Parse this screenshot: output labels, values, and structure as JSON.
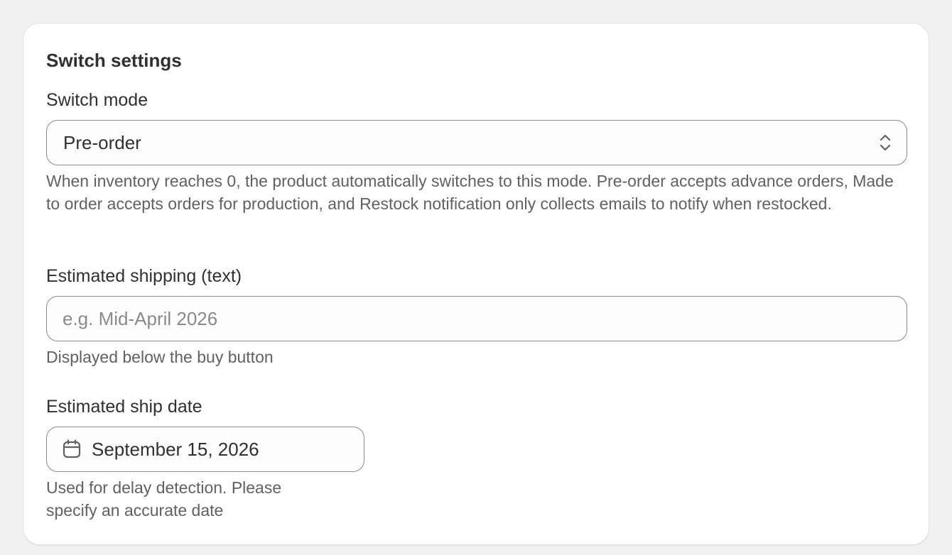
{
  "card": {
    "title": "Switch settings"
  },
  "switch_mode": {
    "label": "Switch mode",
    "selected": "Pre-order",
    "help": "When inventory reaches 0, the product automatically switches to this mode. Pre-order accepts advance orders, Made to order accepts orders for production, and Restock notification only collects emails to notify when restocked."
  },
  "estimated_shipping": {
    "label": "Estimated shipping (text)",
    "value": "",
    "placeholder": "e.g. Mid-April 2026",
    "help": "Displayed below the buy button"
  },
  "ship_date": {
    "label": "Estimated ship date",
    "value": "September 15, 2026",
    "icon": "calendar-icon",
    "help_line1": "Used for delay detection. Please",
    "help_line2": "specify an accurate date"
  },
  "colors": {
    "page_background": "#f1f1f1",
    "card_background": "#ffffff",
    "border": "#8a8a8a",
    "text": "#303030",
    "help_text": "#616161"
  }
}
